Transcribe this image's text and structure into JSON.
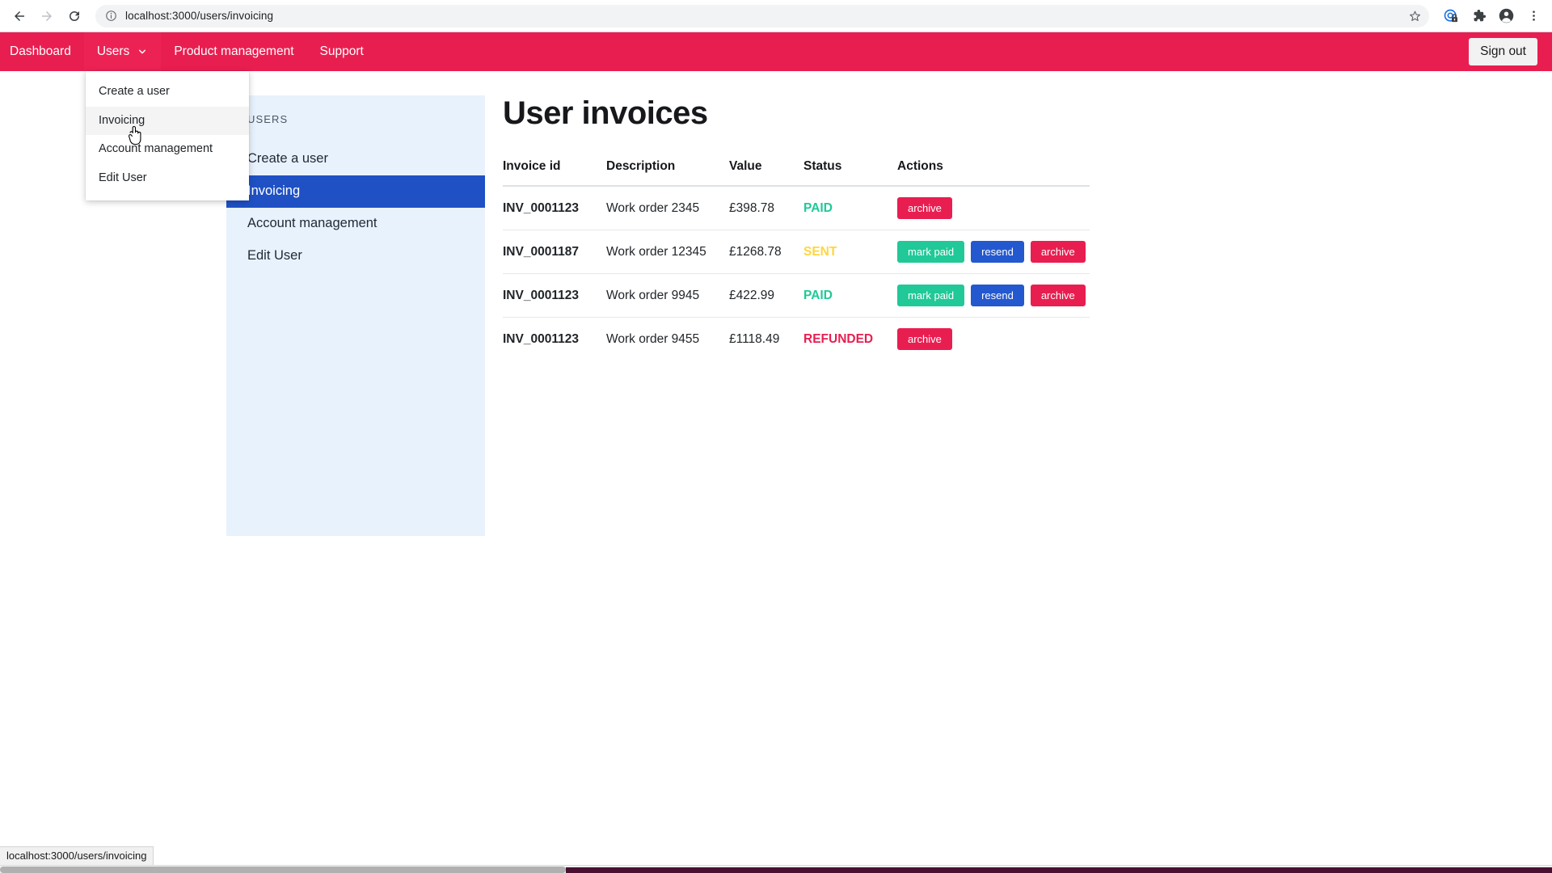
{
  "browser": {
    "back_icon": "back-arrow-icon",
    "forward_icon": "forward-arrow-icon",
    "reload_icon": "reload-icon",
    "site_info_icon": "site-info-icon",
    "url": "localhost:3000/users/invoicing",
    "url_host": "localhost",
    "url_path": ":3000/users/invoicing",
    "star_icon": "bookmark-star-icon",
    "toolbar_icons": [
      "privacy-lock-icon",
      "extensions-puzzle-icon",
      "profile-avatar-icon",
      "chrome-menu-icon"
    ],
    "status_bar_url": "localhost:3000/users/invoicing"
  },
  "topnav": {
    "brand_color": "#e91e50",
    "items": [
      {
        "label": "Dashboard",
        "active": false,
        "has_caret": false
      },
      {
        "label": "Users",
        "active": true,
        "has_caret": true
      },
      {
        "label": "Product management",
        "active": false,
        "has_caret": false
      },
      {
        "label": "Support",
        "active": false,
        "has_caret": false
      }
    ],
    "sign_out_label": "Sign out"
  },
  "dropdown": {
    "open": true,
    "items": [
      {
        "label": "Create a user",
        "hovered": false
      },
      {
        "label": "Invoicing",
        "hovered": true
      },
      {
        "label": "Account management",
        "hovered": false
      },
      {
        "label": "Edit User",
        "hovered": false
      }
    ]
  },
  "sidebar": {
    "heading": "USERS",
    "accent_color": "#1f51c4",
    "background": "#e8f2fd",
    "items": [
      {
        "label": "Create a user",
        "selected": false
      },
      {
        "label": "Invoicing",
        "selected": true
      },
      {
        "label": "Account management",
        "selected": false
      },
      {
        "label": "Edit User",
        "selected": false
      }
    ]
  },
  "main": {
    "title": "User invoices",
    "table": {
      "columns": [
        "Invoice id",
        "Description",
        "Value",
        "Status",
        "Actions"
      ],
      "rows": [
        {
          "invoice_id": "INV_0001123",
          "description": "Work order 2345",
          "value": "£398.78",
          "status": "PAID",
          "status_color": "#20c997",
          "actions": [
            {
              "label": "archive",
              "kind": "archive"
            }
          ]
        },
        {
          "invoice_id": "INV_0001187",
          "description": "Work order 12345",
          "value": "£1268.78",
          "status": "SENT",
          "status_color": "#ffd63d",
          "actions": [
            {
              "label": "mark paid",
              "kind": "mark"
            },
            {
              "label": "resend",
              "kind": "resend"
            },
            {
              "label": "archive",
              "kind": "archive"
            }
          ]
        },
        {
          "invoice_id": "INV_0001123",
          "description": "Work order 9945",
          "value": "£422.99",
          "status": "PAID",
          "status_color": "#20c997",
          "actions": [
            {
              "label": "mark paid",
              "kind": "mark"
            },
            {
              "label": "resend",
              "kind": "resend"
            },
            {
              "label": "archive",
              "kind": "archive"
            }
          ]
        },
        {
          "invoice_id": "INV_0001123",
          "description": "Work order 9455",
          "value": "£1118.49",
          "status": "REFUNDED",
          "status_color": "#e91e50",
          "actions": [
            {
              "label": "archive",
              "kind": "archive"
            }
          ]
        }
      ]
    }
  }
}
